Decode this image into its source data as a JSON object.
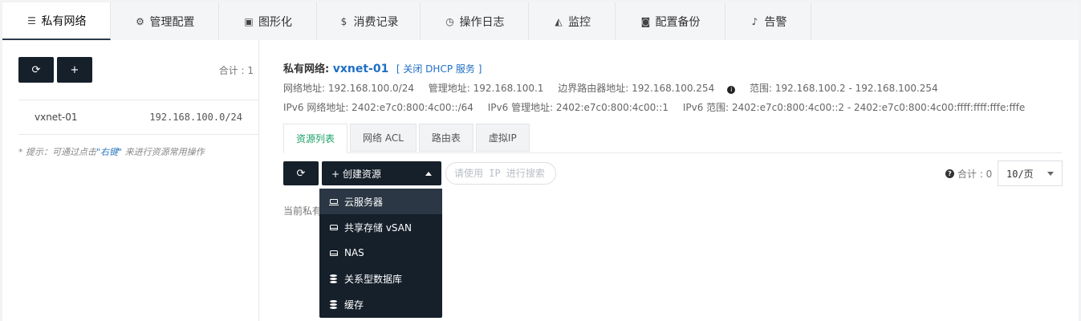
{
  "tabs": [
    {
      "label": "私有网络",
      "icon": "list-icon",
      "glyph": "☰",
      "width": 135,
      "active": true
    },
    {
      "label": "管理配置",
      "icon": "gears-icon",
      "glyph": "⚙",
      "width": 135,
      "active": false
    },
    {
      "label": "图形化",
      "icon": "image-icon",
      "glyph": "▣",
      "width": 122,
      "active": false
    },
    {
      "label": "消费记录",
      "icon": "dollar-icon",
      "glyph": "$",
      "width": 129,
      "active": false
    },
    {
      "label": "操作日志",
      "icon": "clock-icon",
      "glyph": "◷",
      "width": 135,
      "active": false
    },
    {
      "label": "监控",
      "icon": "area-chart-icon",
      "glyph": "◭",
      "width": 108,
      "active": false
    },
    {
      "label": "配置备份",
      "icon": "camera-icon",
      "glyph": "◙",
      "width": 137,
      "active": false
    },
    {
      "label": "告警",
      "icon": "bell-icon",
      "glyph": "♪",
      "width": 107,
      "active": false
    }
  ],
  "left": {
    "refresh_glyph": "⟳",
    "add_glyph": "+",
    "count_label": "合计 : 1",
    "network": {
      "name": "vxnet-01",
      "cidr": "192.168.100.0/24"
    },
    "hint_prefix": "* 提示：可通过点击",
    "hint_key": "\"右键\"",
    "hint_suffix": " 来进行资源常用操作"
  },
  "detail": {
    "label": "私有网络:",
    "name": "vxnet-01",
    "dhcp_link": "[ 关闭 DHCP 服务 ]",
    "network_address": "网络地址: 192.168.100.0/24",
    "manage_address": "管理地址: 192.168.100.1",
    "border_router": "边界路由器地址: 192.168.100.254",
    "info_glyph": "i",
    "range": "范围: 192.168.100.2 - 192.168.100.254",
    "ipv6_network": "IPv6 网络地址: 2402:e7c0:800:4c00::/64",
    "ipv6_manage": "IPv6 管理地址: 2402:e7c0:800:4c00::1",
    "ipv6_range": "IPv6 范围: 2402:e7c0:800:4c00::2 - 2402:e7c0:800:4c00:ffff:ffff:fffe:fffe"
  },
  "subtabs": [
    {
      "label": "资源列表",
      "active": true
    },
    {
      "label": "网络 ACL",
      "active": false
    },
    {
      "label": "路由表",
      "active": false
    },
    {
      "label": "虚拟IP",
      "active": false
    }
  ],
  "toolbar": {
    "refresh_glyph": "⟳",
    "create_label": "+ 创建资源",
    "search_placeholder": "请使用 IP 进行搜索",
    "help_glyph": "?",
    "count_label": "合计 : 0",
    "page_size": "10/页"
  },
  "empty_text": "当前私有",
  "create_menu": [
    {
      "label": "云服务器",
      "icon": "laptop-icon",
      "kind": "laptop"
    },
    {
      "label": "共享存储 vSAN",
      "icon": "hdd-icon",
      "kind": "drive"
    },
    {
      "label": "NAS",
      "icon": "hdd-icon",
      "kind": "drive"
    },
    {
      "label": "关系型数据库",
      "icon": "database-icon",
      "kind": "db"
    },
    {
      "label": "缓存",
      "icon": "database-icon",
      "kind": "db"
    }
  ]
}
